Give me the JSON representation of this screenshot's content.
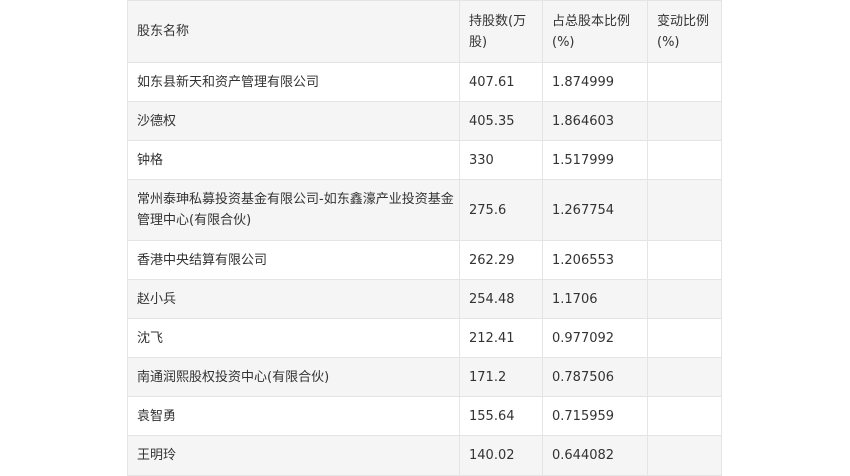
{
  "table": {
    "headers": [
      "股东名称",
      "持股数(万股)",
      "占总股本比例(%)",
      "变动比例(%)"
    ],
    "rows": [
      [
        "如东县新天和资产管理有限公司",
        "407.61",
        "1.874999",
        ""
      ],
      [
        "沙德权",
        "405.35",
        "1.864603",
        ""
      ],
      [
        "钟格",
        "330",
        "1.517999",
        ""
      ],
      [
        "常州泰珅私募投资基金有限公司-如东鑫濠产业投资基金管理中心(有限合伙)",
        "275.6",
        "1.267754",
        ""
      ],
      [
        "香港中央结算有限公司",
        "262.29",
        "1.206553",
        ""
      ],
      [
        "赵小兵",
        "254.48",
        "1.1706",
        ""
      ],
      [
        "沈飞",
        "212.41",
        "0.977092",
        ""
      ],
      [
        "南通润熙股权投资中心(有限合伙)",
        "171.2",
        "0.787506",
        ""
      ],
      [
        "袁智勇",
        "155.64",
        "0.715959",
        ""
      ],
      [
        "王明玲",
        "140.02",
        "0.644082",
        ""
      ]
    ]
  }
}
